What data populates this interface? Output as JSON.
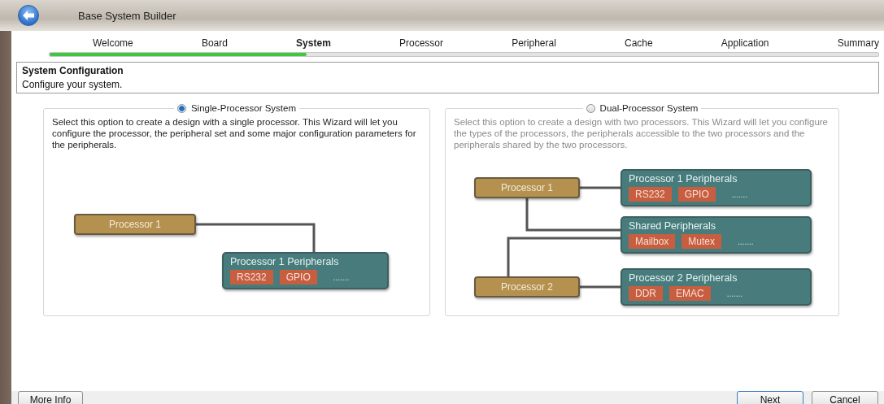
{
  "window": {
    "title": "Base System Builder"
  },
  "steps": [
    {
      "label": "Welcome",
      "selected": false
    },
    {
      "label": "Board",
      "selected": false
    },
    {
      "label": "System",
      "selected": true
    },
    {
      "label": "Processor",
      "selected": false
    },
    {
      "label": "Peripheral",
      "selected": false
    },
    {
      "label": "Cache",
      "selected": false
    },
    {
      "label": "Application",
      "selected": false
    },
    {
      "label": "Summary",
      "selected": false
    }
  ],
  "progress": {
    "level": 0.31
  },
  "header": {
    "title": "System Configuration",
    "subtitle": "Configure your system."
  },
  "options": [
    {
      "kind": "single",
      "label": "Single-Processor System",
      "selected": true,
      "description": "Select this option to create a design with a single processor. This Wizard will let you configure the processor, the peripheral set and some major configuration parameters for the peripherals.",
      "processors": [
        "Processor 1"
      ],
      "groups": [
        {
          "title": "Processor 1 Peripherals",
          "chips": [
            "RS232",
            "GPIO"
          ],
          "more": "......."
        }
      ]
    },
    {
      "kind": "dual",
      "label": "Dual-Processor System",
      "selected": false,
      "description": "Select this option to create a design with two processors. This Wizard will let you configure the types of the processors, the peripherals accessible to the two processors and the peripherals shared by the two processors.",
      "processors": [
        "Processor 1",
        "Processor 2"
      ],
      "groups": [
        {
          "title": "Processor 1 Peripherals",
          "chips": [
            "RS232",
            "GPIO"
          ],
          "more": "......."
        },
        {
          "title": "Shared Peripherals",
          "chips": [
            "Mailbox",
            "Mutex"
          ],
          "more": "......."
        },
        {
          "title": "Processor 2 Peripherals",
          "chips": [
            "DDR",
            "EMAC"
          ],
          "more": "......."
        }
      ]
    }
  ],
  "buttons": {
    "left": [
      "More Info"
    ],
    "right": [
      "Next",
      "Cancel"
    ]
  }
}
